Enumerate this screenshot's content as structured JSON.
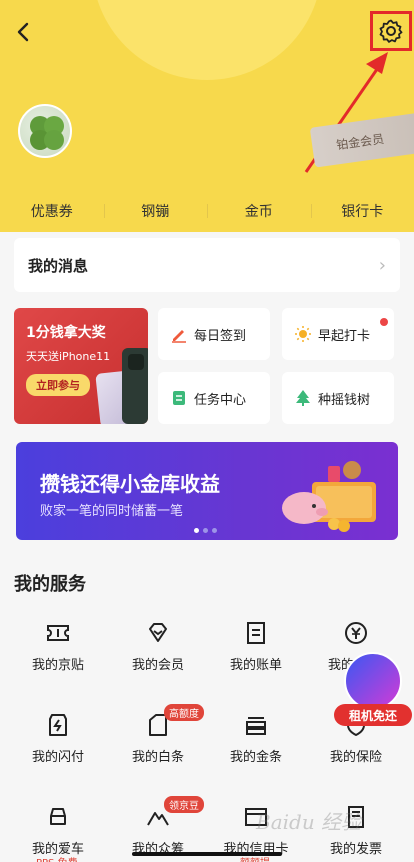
{
  "header": {
    "back_icon": "chevron-left-icon",
    "settings_icon": "gear-icon",
    "avatar_icon": "four-leaf-clover-avatar",
    "vip_badge": "铂金会员",
    "bg_color": "#f7d94c"
  },
  "tabs": [
    {
      "label": "优惠券"
    },
    {
      "label": "钢镚"
    },
    {
      "label": "金币"
    },
    {
      "label": "银行卡"
    }
  ],
  "messages": {
    "title": "我的消息"
  },
  "promo": {
    "title": "1分钱拿大奖",
    "subtitle": "天天送iPhone11",
    "button": "立即参与"
  },
  "tiles": [
    {
      "label": "每日签到",
      "icon": "pencil-icon"
    },
    {
      "label": "早起打卡",
      "icon": "sun-icon"
    },
    {
      "label": "任务中心",
      "icon": "document-icon"
    },
    {
      "label": "种摇钱树",
      "icon": "tree-icon"
    }
  ],
  "banner": {
    "title": "攒钱还得小金库收益",
    "subtitle": "败家一笔的同时储蓄一笔"
  },
  "services": {
    "title": "我的服务",
    "items": [
      {
        "label": "我的京贴",
        "icon": "ticket-icon"
      },
      {
        "label": "我的会员",
        "icon": "diamond-icon"
      },
      {
        "label": "我的账单",
        "icon": "bill-icon"
      },
      {
        "label": "我的",
        "icon": "yen-icon"
      },
      {
        "label": "我的闪付",
        "icon": "flash-pay-icon"
      },
      {
        "label": "我的白条",
        "icon": "card-icon",
        "tag": "高额度"
      },
      {
        "label": "我的金条",
        "icon": "gold-bar-icon"
      },
      {
        "label": "我的保险",
        "icon": "shield-icon"
      },
      {
        "label": "我的爱车",
        "icon": "car-icon",
        "sub": "PPS 免费"
      },
      {
        "label": "我的众筹",
        "icon": "mountain-icon",
        "tag": "领京豆"
      },
      {
        "label": "我的信用卡",
        "icon": "credit-card-icon",
        "sub": "额额提"
      },
      {
        "label": "我的发票",
        "icon": "invoice-icon"
      }
    ]
  },
  "float_ad": {
    "label": "租机免还"
  },
  "watermark": "Baidu 经验"
}
